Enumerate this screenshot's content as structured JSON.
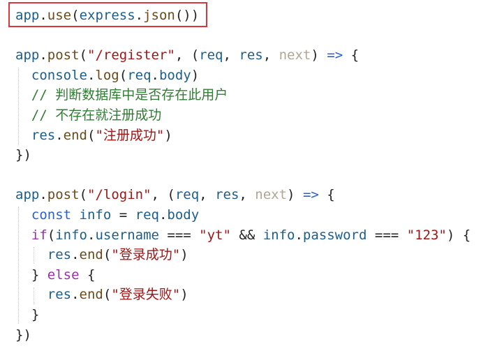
{
  "colors": {
    "identifier": "#1b5e8c",
    "function": "#6a4a1b",
    "string": "#a31515",
    "keyword": "#9b2fae",
    "param_unused": "#b0a694",
    "operator": "#2a5fd1",
    "comment": "#2e7d32",
    "punct_brace": "#c08a00",
    "highlight_border": "#d9363e"
  },
  "code": {
    "lines": [
      [
        {
          "t": "app",
          "c": "identifier"
        },
        {
          "t": ".",
          "c": "plain"
        },
        {
          "t": "use",
          "c": "function"
        },
        {
          "t": "(",
          "c": "plain"
        },
        {
          "t": "express",
          "c": "identifier"
        },
        {
          "t": ".",
          "c": "plain"
        },
        {
          "t": "json",
          "c": "function"
        },
        {
          "t": "())",
          "c": "plain"
        }
      ],
      [],
      [
        {
          "t": "app",
          "c": "identifier"
        },
        {
          "t": ".",
          "c": "plain"
        },
        {
          "t": "post",
          "c": "function"
        },
        {
          "t": "(",
          "c": "plain"
        },
        {
          "t": "\"/register\"",
          "c": "string"
        },
        {
          "t": ", (",
          "c": "plain"
        },
        {
          "t": "req",
          "c": "identifier"
        },
        {
          "t": ", ",
          "c": "plain"
        },
        {
          "t": "res",
          "c": "identifier"
        },
        {
          "t": ", ",
          "c": "plain"
        },
        {
          "t": "next",
          "c": "param_unused"
        },
        {
          "t": ") ",
          "c": "plain"
        },
        {
          "t": "=>",
          "c": "operator"
        },
        {
          "t": " {",
          "c": "plain"
        }
      ],
      [
        {
          "t": "  console",
          "c": "identifier"
        },
        {
          "t": ".",
          "c": "plain"
        },
        {
          "t": "log",
          "c": "function"
        },
        {
          "t": "(",
          "c": "plain"
        },
        {
          "t": "req",
          "c": "identifier"
        },
        {
          "t": ".",
          "c": "plain"
        },
        {
          "t": "body",
          "c": "identifier"
        },
        {
          "t": ")",
          "c": "plain"
        }
      ],
      [
        {
          "t": "  // 判断数据库中是否存在此用户",
          "c": "comment"
        }
      ],
      [
        {
          "t": "  // 不存在就注册成功",
          "c": "comment"
        }
      ],
      [
        {
          "t": "  res",
          "c": "identifier"
        },
        {
          "t": ".",
          "c": "plain"
        },
        {
          "t": "end",
          "c": "function"
        },
        {
          "t": "(",
          "c": "plain"
        },
        {
          "t": "\"注册成功\"",
          "c": "string"
        },
        {
          "t": ")",
          "c": "plain"
        }
      ],
      [
        {
          "t": "})",
          "c": "plain"
        }
      ],
      [],
      [
        {
          "t": "app",
          "c": "identifier"
        },
        {
          "t": ".",
          "c": "plain"
        },
        {
          "t": "post",
          "c": "function"
        },
        {
          "t": "(",
          "c": "plain"
        },
        {
          "t": "\"/login\"",
          "c": "string"
        },
        {
          "t": ", (",
          "c": "plain"
        },
        {
          "t": "req",
          "c": "identifier"
        },
        {
          "t": ", ",
          "c": "plain"
        },
        {
          "t": "res",
          "c": "identifier"
        },
        {
          "t": ", ",
          "c": "plain"
        },
        {
          "t": "next",
          "c": "param_unused"
        },
        {
          "t": ") ",
          "c": "plain"
        },
        {
          "t": "=>",
          "c": "operator"
        },
        {
          "t": " {",
          "c": "plain"
        }
      ],
      [
        {
          "t": "  ",
          "c": "plain"
        },
        {
          "t": "const",
          "c": "operator"
        },
        {
          "t": " ",
          "c": "plain"
        },
        {
          "t": "info",
          "c": "identifier"
        },
        {
          "t": " = ",
          "c": "plain"
        },
        {
          "t": "req",
          "c": "identifier"
        },
        {
          "t": ".",
          "c": "plain"
        },
        {
          "t": "body",
          "c": "identifier"
        }
      ],
      [
        {
          "t": "  ",
          "c": "plain"
        },
        {
          "t": "if",
          "c": "keyword"
        },
        {
          "t": "(",
          "c": "plain"
        },
        {
          "t": "info",
          "c": "identifier"
        },
        {
          "t": ".",
          "c": "plain"
        },
        {
          "t": "username",
          "c": "identifier"
        },
        {
          "t": " === ",
          "c": "plain"
        },
        {
          "t": "\"yt\"",
          "c": "string"
        },
        {
          "t": " && ",
          "c": "plain"
        },
        {
          "t": "info",
          "c": "identifier"
        },
        {
          "t": ".",
          "c": "plain"
        },
        {
          "t": "password",
          "c": "identifier"
        },
        {
          "t": " === ",
          "c": "plain"
        },
        {
          "t": "\"123\"",
          "c": "string"
        },
        {
          "t": ") {",
          "c": "plain"
        }
      ],
      [
        {
          "t": "    res",
          "c": "identifier"
        },
        {
          "t": ".",
          "c": "plain"
        },
        {
          "t": "end",
          "c": "function"
        },
        {
          "t": "(",
          "c": "plain"
        },
        {
          "t": "\"登录成功\"",
          "c": "string"
        },
        {
          "t": ")",
          "c": "plain"
        }
      ],
      [
        {
          "t": "  } ",
          "c": "plain"
        },
        {
          "t": "else",
          "c": "keyword"
        },
        {
          "t": " {",
          "c": "plain"
        }
      ],
      [
        {
          "t": "    res",
          "c": "identifier"
        },
        {
          "t": ".",
          "c": "plain"
        },
        {
          "t": "end",
          "c": "function"
        },
        {
          "t": "(",
          "c": "plain"
        },
        {
          "t": "\"登录失败\"",
          "c": "string"
        },
        {
          "t": ")",
          "c": "plain"
        }
      ],
      [
        {
          "t": "  }",
          "c": "plain"
        }
      ],
      [
        {
          "t": "})",
          "c": "plain"
        }
      ]
    ]
  }
}
